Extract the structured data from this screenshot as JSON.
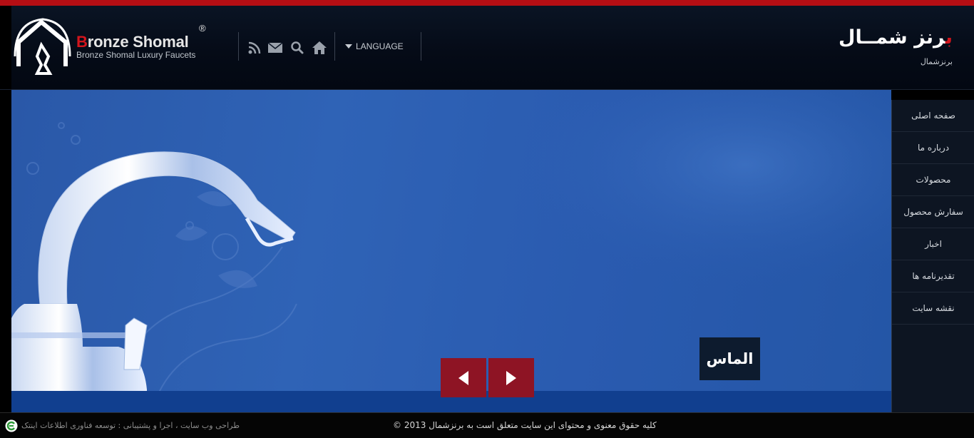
{
  "header": {
    "brand_first_letter": "B",
    "brand_rest": "ronze Shomal",
    "brand_registered": "®",
    "tagline": "Bronze Shomal Luxury Faucets",
    "language_label": "LANGUAGE",
    "fa_logo_red": "ب",
    "fa_logo_rest": "رنز شمــال",
    "fa_subtitle": "برنزشمال",
    "icons": [
      "rss-icon",
      "mail-icon",
      "search-icon",
      "home-icon"
    ]
  },
  "hero": {
    "caption": "الماس",
    "prev_label": "previous",
    "next_label": "next"
  },
  "menu": {
    "items": [
      {
        "label": "صفحه اصلی"
      },
      {
        "label": "درباره ما"
      },
      {
        "label": "محصولات"
      },
      {
        "label": "سفارش محصول"
      },
      {
        "label": "اخبار"
      },
      {
        "label": "تقدیرنامه ها"
      },
      {
        "label": "نقشه سایت"
      }
    ]
  },
  "footer": {
    "credit": "طراحی وب سایت ، اجرا و پشتیبانی : توسعه فناوری اطلاعات اینتک",
    "copyright": "کلیه حقوق معنوی و محتوای این سایت متعلق است به برنزشمال 2013 ©"
  },
  "colors": {
    "brand_red": "#d3151c",
    "nav_button": "#8e1424",
    "hero_blue": "#2f63b6",
    "header_dark": "#050b17"
  }
}
